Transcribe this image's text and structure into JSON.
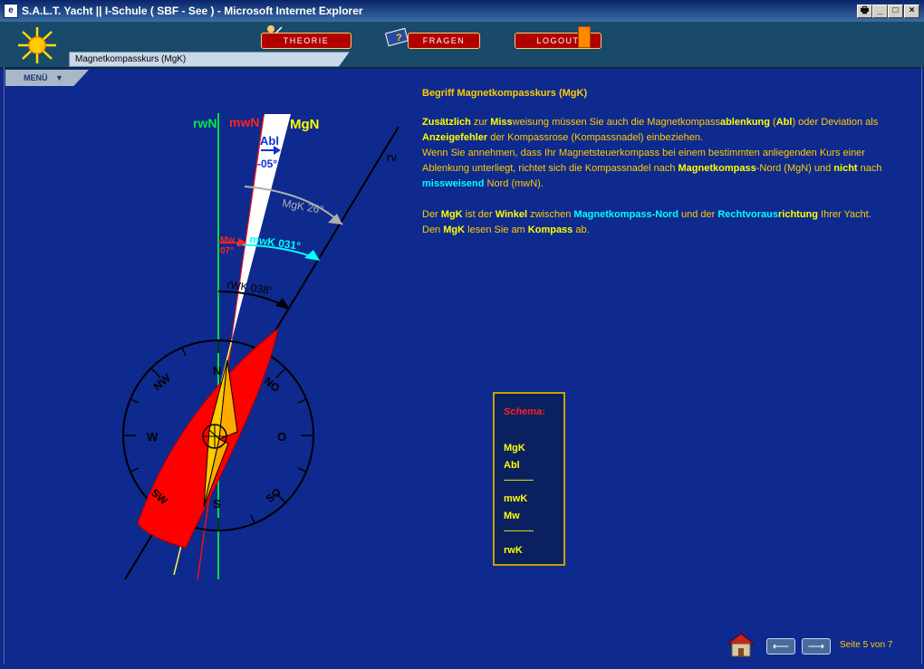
{
  "window": {
    "title": "S.A.L.T. Yacht || I-Schule ( SBF - See ) - Microsoft Internet Explorer",
    "controls": [
      "🖶",
      "_",
      "□",
      "×"
    ]
  },
  "nav": {
    "theorie": "THEORIE",
    "fragen": "FRAGEN",
    "logout": "LOGOUT"
  },
  "breadcrumb": "Magnetkompasskurs (MgK)",
  "menu_label": "MENÜ",
  "content": {
    "heading": "Begriff Magnetkompasskurs (MgK)",
    "p1": {
      "t1": "Zusätzlich",
      "t2": " zur ",
      "t3": "Miss",
      "t4": "weisung müssen Sie auch die Magnetkompass",
      "t5": "ablenkung",
      "t6": " (",
      "t7": "Abl",
      "t8": ") oder Deviation als ",
      "t9": "Anzeigefehler",
      "t10": " der Kompassrose (Kompassnadel) einbeziehen.",
      "t11": "Wenn Sie annehmen, dass Ihr Magnetsteuerkompass bei einem bestimmten anliegenden Kurs einer Ablenkung unterliegt, richtet sich die Kompassnadel nach ",
      "t12": "Magnetkompass",
      "t13": "-Nord (MgN) und ",
      "t14": "nicht",
      "t15": " nach ",
      "t16": "missweisend",
      "t17": " Nord (mwN)."
    },
    "p2": {
      "t1": "Der ",
      "t2": "MgK",
      "t3": " ist der ",
      "t4": "Winkel",
      "t5": " zwischen ",
      "t6": "Magnetkompass-Nord",
      "t7": " und der ",
      "t8": "Rechtvoraus",
      "t9": "richtung",
      "t10": " Ihrer Yacht.",
      "t11": "Den ",
      "t12": "MgK",
      "t13": " lesen Sie am ",
      "t14": "Kompass",
      "t15": " ab."
    }
  },
  "diagram": {
    "rwN": "rwN",
    "mwN": "mwN",
    "MgN": "MgN",
    "rv": "rv",
    "abl": "Abl",
    "abl_val": "-05°",
    "mgk": "MgK 26°",
    "mwk": "mwK 031°",
    "mw": "Mw",
    "mw_val": "07°",
    "rwk": "rWK 038°",
    "compass": {
      "N": "N",
      "NO": "NO",
      "O": "O",
      "SO": "SO",
      "S": "S",
      "SW": "SW",
      "W": "W",
      "NW": "NW"
    }
  },
  "schema": {
    "title": "Schema:",
    "l1": "MgK",
    "l2": "Abl",
    "sep1": "-----------",
    "l3": "mwK",
    "l4": "Mw",
    "sep2": "-----------",
    "l5": "rwK"
  },
  "footer": {
    "prev": "⟵",
    "next": "⟶",
    "page": "Seite 5 von 7"
  },
  "colors": {
    "background": "#0e2a8e",
    "text": "#ffcc00",
    "highlight_yellow": "#ffff00",
    "highlight_cyan": "#00ffff",
    "boat": "#ff0000",
    "nav_button": "#b00000"
  }
}
